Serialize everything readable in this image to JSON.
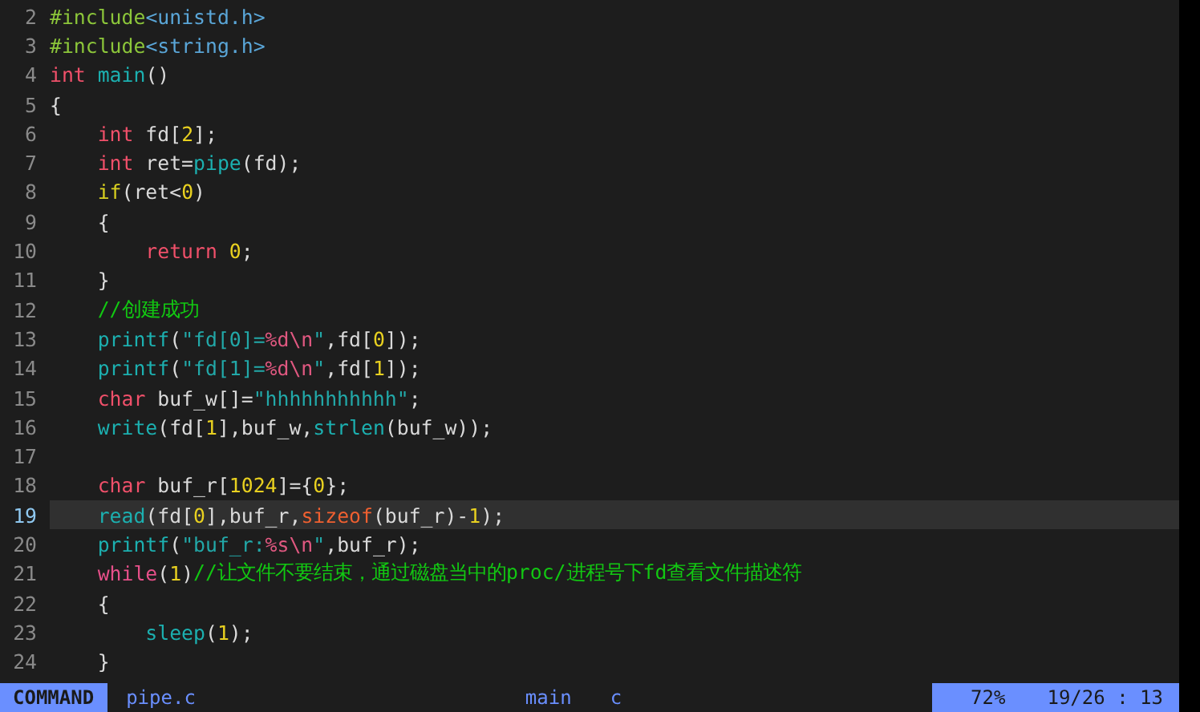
{
  "editor": {
    "lines": [
      {
        "number": "2",
        "selected": false,
        "tokens": [
          {
            "kind": "pre",
            "text": "#include"
          },
          {
            "kind": "hdr",
            "text": "<unistd.h>"
          }
        ]
      },
      {
        "number": "3",
        "selected": false,
        "tokens": [
          {
            "kind": "pre",
            "text": "#include"
          },
          {
            "kind": "hdr",
            "text": "<string.h>"
          }
        ]
      },
      {
        "number": "4",
        "selected": false,
        "tokens": [
          {
            "kind": "type",
            "text": "int"
          },
          {
            "kind": "fn",
            "text": " main"
          },
          {
            "kind": "plain",
            "text": "()"
          }
        ]
      },
      {
        "number": "5",
        "selected": false,
        "tokens": [
          {
            "kind": "plain",
            "text": "{"
          }
        ]
      },
      {
        "number": "6",
        "selected": false,
        "tokens": [
          {
            "kind": "type",
            "text": "    int"
          },
          {
            "kind": "plain",
            "text": " fd["
          },
          {
            "kind": "num",
            "text": "2"
          },
          {
            "kind": "plain",
            "text": "];"
          }
        ]
      },
      {
        "number": "7",
        "selected": false,
        "tokens": [
          {
            "kind": "type",
            "text": "    int"
          },
          {
            "kind": "plain",
            "text": " ret="
          },
          {
            "kind": "fn",
            "text": "pipe"
          },
          {
            "kind": "plain",
            "text": "(fd);"
          }
        ]
      },
      {
        "number": "8",
        "selected": false,
        "tokens": [
          {
            "kind": "cond",
            "text": "    if"
          },
          {
            "kind": "plain",
            "text": "(ret<"
          },
          {
            "kind": "num",
            "text": "0"
          },
          {
            "kind": "plain",
            "text": ")"
          }
        ]
      },
      {
        "number": "9",
        "selected": false,
        "tokens": [
          {
            "kind": "plain",
            "text": "    {"
          }
        ]
      },
      {
        "number": "10",
        "selected": false,
        "tokens": [
          {
            "kind": "type",
            "text": "        return"
          },
          {
            "kind": "num",
            "text": " 0"
          },
          {
            "kind": "plain",
            "text": ";"
          }
        ]
      },
      {
        "number": "11",
        "selected": false,
        "tokens": [
          {
            "kind": "plain",
            "text": "    }"
          }
        ]
      },
      {
        "number": "12",
        "selected": false,
        "tokens": [
          {
            "kind": "comment",
            "text": "    //创建成功"
          }
        ]
      },
      {
        "number": "13",
        "selected": false,
        "tokens": [
          {
            "kind": "fn",
            "text": "    printf"
          },
          {
            "kind": "plain",
            "text": "("
          },
          {
            "kind": "str",
            "text": "\"fd[0]="
          },
          {
            "kind": "fmt",
            "text": "%d\\n"
          },
          {
            "kind": "str",
            "text": "\""
          },
          {
            "kind": "plain",
            "text": ",fd["
          },
          {
            "kind": "num",
            "text": "0"
          },
          {
            "kind": "plain",
            "text": "]);"
          }
        ]
      },
      {
        "number": "14",
        "selected": false,
        "tokens": [
          {
            "kind": "fn",
            "text": "    printf"
          },
          {
            "kind": "plain",
            "text": "("
          },
          {
            "kind": "str",
            "text": "\"fd[1]="
          },
          {
            "kind": "fmt",
            "text": "%d\\n"
          },
          {
            "kind": "str",
            "text": "\""
          },
          {
            "kind": "plain",
            "text": ",fd["
          },
          {
            "kind": "num",
            "text": "1"
          },
          {
            "kind": "plain",
            "text": "]);"
          }
        ]
      },
      {
        "number": "15",
        "selected": false,
        "tokens": [
          {
            "kind": "type",
            "text": "    char"
          },
          {
            "kind": "plain",
            "text": " buf_w[]="
          },
          {
            "kind": "str",
            "text": "\"hhhhhhhhhhh\""
          },
          {
            "kind": "plain",
            "text": ";"
          }
        ]
      },
      {
        "number": "16",
        "selected": false,
        "tokens": [
          {
            "kind": "fn",
            "text": "    write"
          },
          {
            "kind": "plain",
            "text": "(fd["
          },
          {
            "kind": "num",
            "text": "1"
          },
          {
            "kind": "plain",
            "text": "],buf_w,"
          },
          {
            "kind": "fn",
            "text": "strlen"
          },
          {
            "kind": "plain",
            "text": "(buf_w));"
          }
        ]
      },
      {
        "number": "17",
        "selected": false
      },
      {
        "number": "18",
        "selected": false,
        "tokens": [
          {
            "kind": "type",
            "text": "    char"
          },
          {
            "kind": "plain",
            "text": " buf_r["
          },
          {
            "kind": "num",
            "text": "1024"
          },
          {
            "kind": "plain",
            "text": "]={"
          },
          {
            "kind": "num",
            "text": "0"
          },
          {
            "kind": "plain",
            "text": "};"
          }
        ]
      },
      {
        "number": "19",
        "selected": true,
        "tokens": [
          {
            "kind": "fn",
            "text": "    read"
          },
          {
            "kind": "plain",
            "text": "(fd["
          },
          {
            "kind": "num",
            "text": "0"
          },
          {
            "kind": "plain",
            "text": "],buf_r,"
          },
          {
            "kind": "op",
            "text": "sizeof"
          },
          {
            "kind": "plain",
            "text": "(buf_r)-"
          },
          {
            "kind": "num",
            "text": "1"
          },
          {
            "kind": "plain",
            "text": ");"
          }
        ]
      },
      {
        "number": "20",
        "selected": false,
        "tokens": [
          {
            "kind": "fn",
            "text": "    printf"
          },
          {
            "kind": "plain",
            "text": "("
          },
          {
            "kind": "str",
            "text": "\"buf_r:"
          },
          {
            "kind": "fmt",
            "text": "%s\\n"
          },
          {
            "kind": "str",
            "text": "\""
          },
          {
            "kind": "plain",
            "text": ",buf_r);"
          }
        ]
      },
      {
        "number": "21",
        "selected": false,
        "tokens": [
          {
            "kind": "loop",
            "text": "    while"
          },
          {
            "kind": "plain",
            "text": "("
          },
          {
            "kind": "num",
            "text": "1"
          },
          {
            "kind": "plain",
            "text": ")"
          },
          {
            "kind": "comment",
            "text": "//让文件不要结束，通过磁盘当中的proc/进程号下fd查看文件描述符"
          }
        ]
      },
      {
        "number": "22",
        "selected": false,
        "tokens": [
          {
            "kind": "plain",
            "text": "    {"
          }
        ]
      },
      {
        "number": "23",
        "selected": false,
        "tokens": [
          {
            "kind": "fn",
            "text": "        sleep"
          },
          {
            "kind": "plain",
            "text": "("
          },
          {
            "kind": "num",
            "text": "1"
          },
          {
            "kind": "plain",
            "text": ");"
          }
        ]
      },
      {
        "number": "24",
        "selected": false,
        "tokens": [
          {
            "kind": "plain",
            "text": "    }"
          }
        ]
      }
    ]
  },
  "status_bar": {
    "mode": "COMMAND",
    "file": "pipe.c",
    "branch": "main",
    "filetype": "c",
    "percent": "72%",
    "position": "19/26 : 13"
  }
}
